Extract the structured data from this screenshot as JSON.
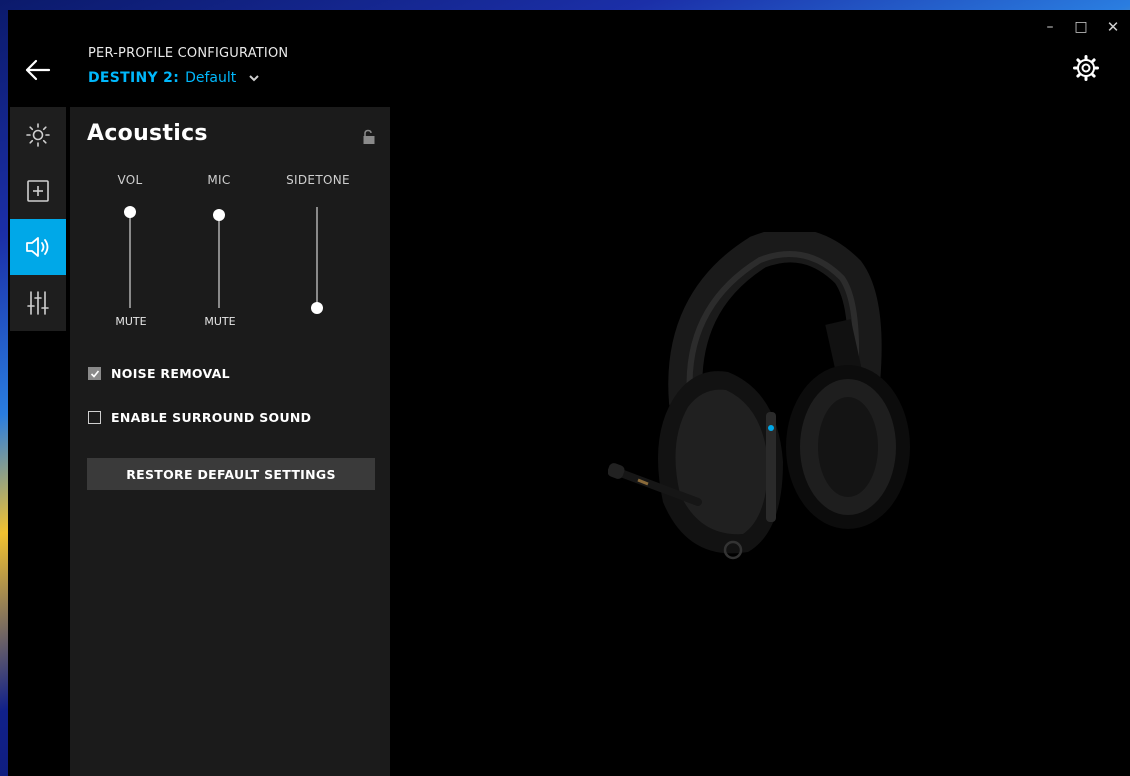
{
  "header": {
    "subtitle": "PER-PROFILE CONFIGURATION",
    "game": "DESTINY 2:",
    "profile": "Default"
  },
  "rail": {
    "items": [
      {
        "icon": "brightness-icon",
        "active": false
      },
      {
        "icon": "add-square-icon",
        "active": false
      },
      {
        "icon": "speaker-icon",
        "active": true
      },
      {
        "icon": "equalizer-icon",
        "active": false
      }
    ]
  },
  "panel": {
    "title": "Acoustics",
    "sliders": [
      {
        "label": "VOL",
        "bottom_label": "MUTE",
        "level": 1.0
      },
      {
        "label": "MIC",
        "bottom_label": "MUTE",
        "level": 0.97
      },
      {
        "label": "SIDETONE",
        "bottom_label": "",
        "level": 0.0
      }
    ],
    "checkboxes": [
      {
        "label": "NOISE REMOVAL",
        "checked": true
      },
      {
        "label": "ENABLE SURROUND SOUND",
        "checked": false
      }
    ],
    "restore_label": "RESTORE DEFAULT SETTINGS"
  },
  "colors": {
    "accent": "#00b8fc",
    "active_rail": "#00a8e8",
    "panel_bg": "#1b1b1b"
  }
}
